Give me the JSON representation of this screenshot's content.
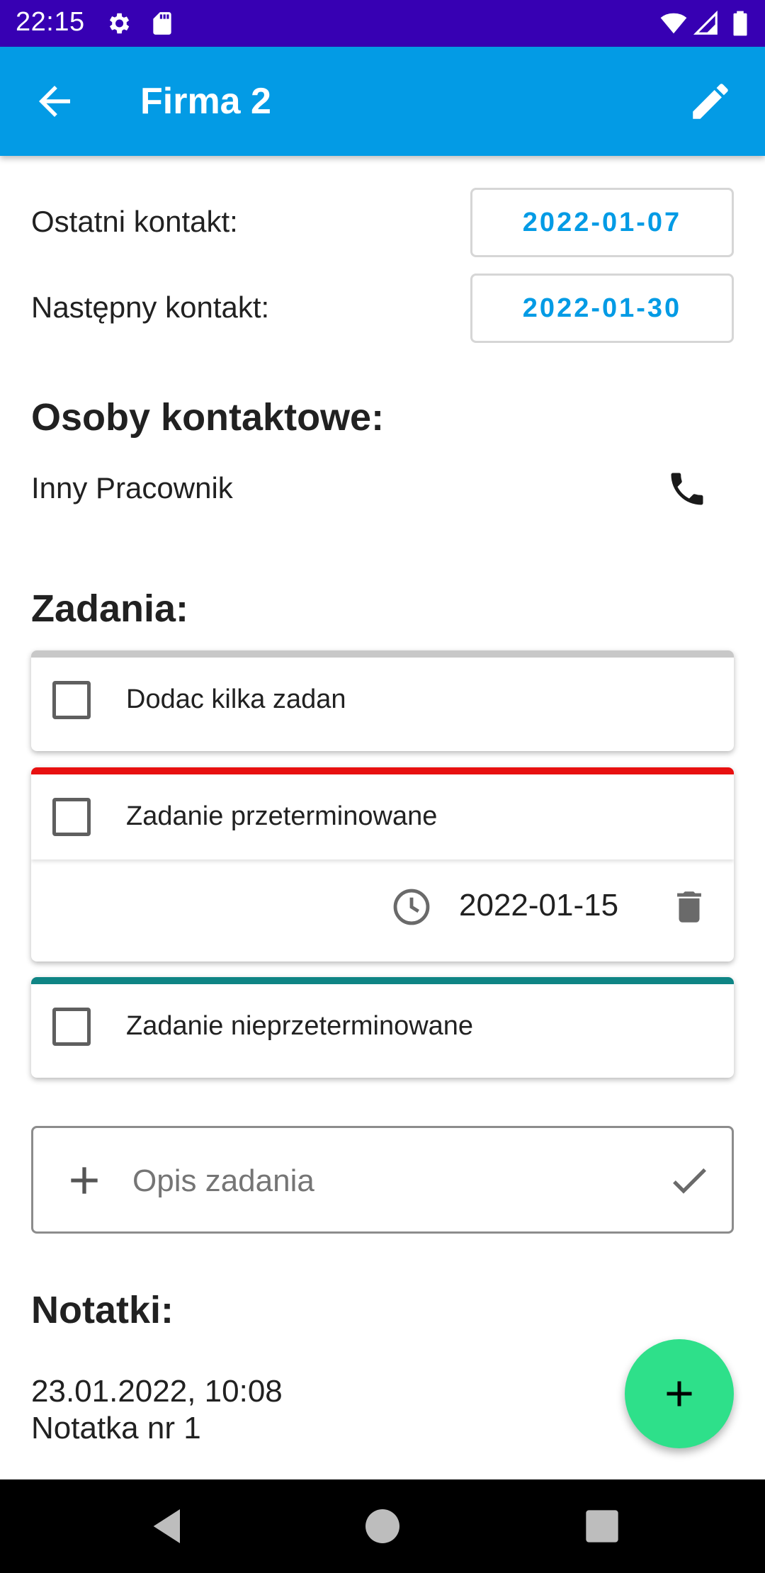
{
  "status_bar": {
    "time": "22:15",
    "icons": [
      "settings-icon",
      "sd-card-icon",
      "wifi-icon",
      "signal-icon",
      "battery-icon"
    ],
    "background": "#3700b3"
  },
  "app_bar": {
    "title": "Firma 2",
    "back_icon": "arrow-back-icon",
    "edit_icon": "edit-pencil-icon",
    "background": "#039be5"
  },
  "contact": {
    "last_label": "Ostatni kontakt:",
    "last_value": "2022-01-07",
    "next_label": "Następny kontakt:",
    "next_value": "2022-01-30",
    "accent": "#039be5"
  },
  "persons": {
    "title": "Osoby kontaktowe:",
    "items": [
      {
        "name": "Inny Pracownik",
        "action_icon": "phone-icon"
      }
    ]
  },
  "tasks": {
    "title": "Zadania:",
    "items": [
      {
        "text": "Dodac kilka zadan",
        "checked": false,
        "strip_color": "#c8c8c8"
      },
      {
        "text": "Zadanie przeterminowane",
        "checked": false,
        "strip_color": "#e81010",
        "due_date": "2022-01-15",
        "expanded": true
      },
      {
        "text": "Zadanie nieprzeterminowane",
        "checked": false,
        "strip_color": "#0f8585"
      }
    ],
    "new_task": {
      "placeholder": "Opis zadania",
      "value": "",
      "add_icon": "plus-icon",
      "confirm_icon": "check-icon"
    }
  },
  "notes": {
    "title": "Notatki:",
    "items": [
      {
        "timestamp": "23.01.2022, 10:08",
        "text": "Notatka nr 1"
      }
    ]
  },
  "fab": {
    "icon": "plus-icon",
    "color": "#2ee08a"
  },
  "nav_bar": {
    "buttons": [
      "back-triangle-icon",
      "home-circle-icon",
      "recents-square-icon"
    ]
  }
}
